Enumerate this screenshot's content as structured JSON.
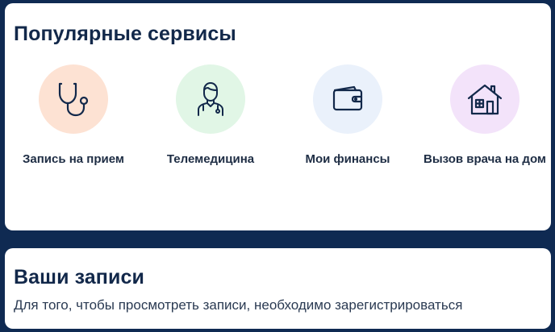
{
  "services": {
    "title": "Популярные сервисы",
    "items": [
      {
        "label": "Запись на прием",
        "icon": "stethoscope-icon",
        "color": "#fde2d3"
      },
      {
        "label": "Телемедицина",
        "icon": "doctor-icon",
        "color": "#e1f6e6"
      },
      {
        "label": "Мои финансы",
        "icon": "wallet-icon",
        "color": "#eaf1fb"
      },
      {
        "label": "Вызов врача на дом",
        "icon": "house-icon",
        "color": "#f3e3fa"
      }
    ]
  },
  "records": {
    "title": "Ваши записи",
    "message": "Для того, чтобы просмотреть записи, необходимо зарегистрироваться"
  }
}
